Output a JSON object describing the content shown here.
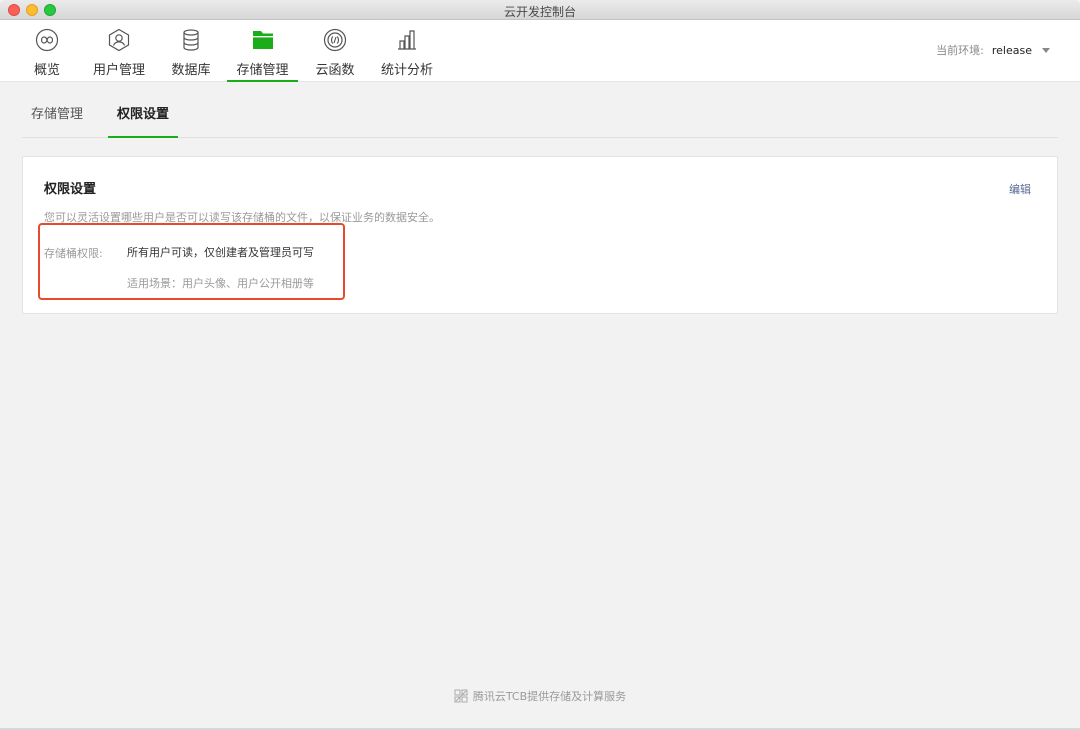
{
  "window": {
    "title": "云开发控制台"
  },
  "nav": {
    "items": [
      {
        "label": "概览",
        "icon": "overview-icon"
      },
      {
        "label": "用户管理",
        "icon": "user-icon"
      },
      {
        "label": "数据库",
        "icon": "database-icon"
      },
      {
        "label": "存储管理",
        "icon": "folder-icon",
        "active": true
      },
      {
        "label": "云函数",
        "icon": "function-icon"
      },
      {
        "label": "统计分析",
        "icon": "stats-icon"
      }
    ],
    "env_label": "当前环境:",
    "env_value": "release"
  },
  "subtabs": [
    {
      "label": "存储管理"
    },
    {
      "label": "权限设置",
      "active": true
    }
  ],
  "card": {
    "title": "权限设置",
    "edit": "编辑",
    "description": "您可以灵活设置哪些用户是否可以读写该存储桶的文件，以保证业务的数据安全。",
    "perm_label": "存储桶权限:",
    "perm_value": "所有用户可读，仅创建者及管理员可写",
    "perm_scene": "适用场景：用户头像、用户公开相册等"
  },
  "footer": {
    "text": "腾讯云TCB提供存储及计算服务"
  },
  "colors": {
    "accent": "#1aad19",
    "link": "#576b95",
    "highlight": "#e84b2c"
  }
}
